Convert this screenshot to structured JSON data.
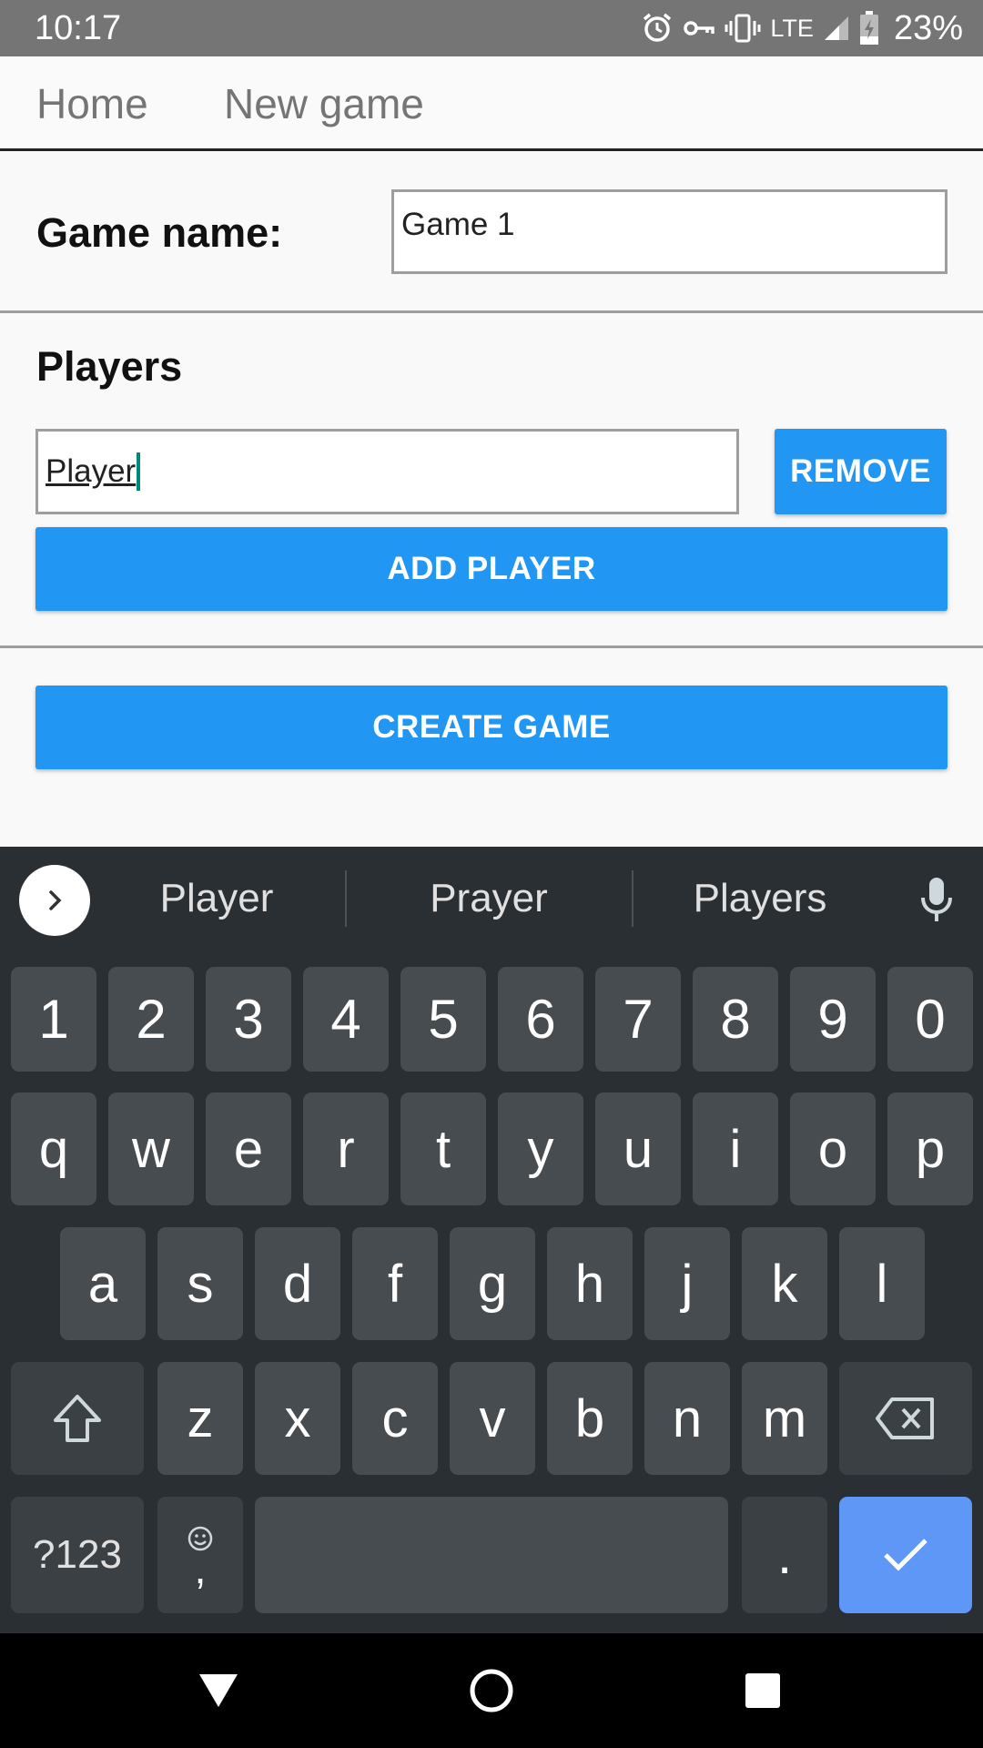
{
  "status_bar": {
    "time": "10:17",
    "network": "LTE",
    "battery": "23%"
  },
  "nav": {
    "home": "Home",
    "new_game": "New game"
  },
  "form": {
    "game_name_label": "Game name:",
    "game_name_value": "Game 1",
    "players_heading": "Players",
    "player_value": "Player",
    "remove_label": "REMOVE",
    "add_player_label": "ADD PLAYER",
    "create_game_label": "CREATE GAME"
  },
  "keyboard": {
    "suggestions": [
      "Player",
      "Prayer",
      "Players"
    ],
    "row_numbers": [
      "1",
      "2",
      "3",
      "4",
      "5",
      "6",
      "7",
      "8",
      "9",
      "0"
    ],
    "row_1": [
      "q",
      "w",
      "e",
      "r",
      "t",
      "y",
      "u",
      "i",
      "o",
      "p"
    ],
    "row_2": [
      "a",
      "s",
      "d",
      "f",
      "g",
      "h",
      "j",
      "k",
      "l"
    ],
    "row_3": [
      "z",
      "x",
      "c",
      "v",
      "b",
      "n",
      "m"
    ],
    "symbols_label": "?123",
    "comma_label": ",",
    "period_label": "."
  },
  "colors": {
    "accent": "#2196f3",
    "keyboard_bg": "#2a2f33",
    "key_bg": "#474c50",
    "enter_key": "#5e97f6",
    "caret": "#00897b"
  }
}
